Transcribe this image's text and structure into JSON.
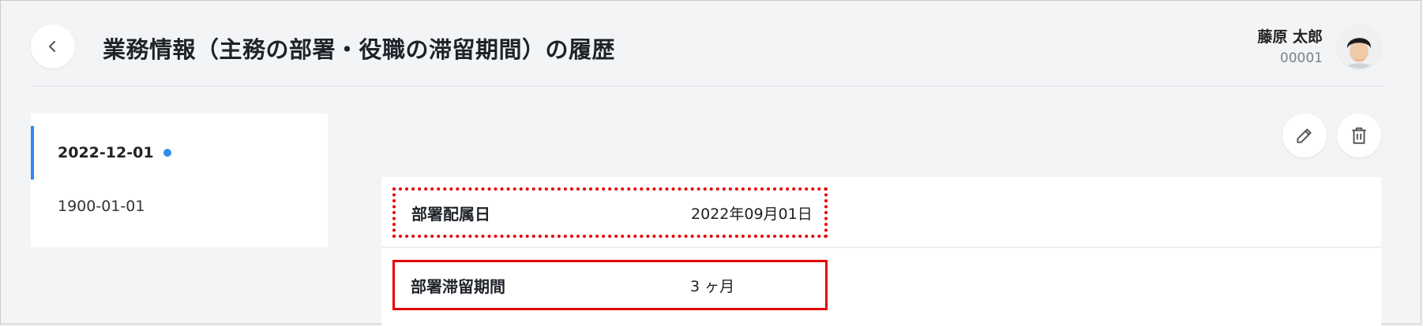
{
  "header": {
    "title": "業務情報（主務の部署・役職の滞留期間）の履歴",
    "user_name": "藤原 太郎",
    "user_id": "00001"
  },
  "history": {
    "items": [
      {
        "date": "2022-12-01",
        "active": true
      },
      {
        "date": "1900-01-01",
        "active": false
      }
    ]
  },
  "details": [
    {
      "label": "部署配属日",
      "value": "2022年09月01日"
    },
    {
      "label": "部署滞留期間",
      "value": "3 ヶ月"
    }
  ],
  "colors": {
    "accent": "#2d8cf0",
    "highlight": "#e60000",
    "background": "#f3f4f6"
  },
  "icons": [
    "chevron-left-icon",
    "avatar-photo",
    "pencil-icon",
    "trash-icon"
  ]
}
